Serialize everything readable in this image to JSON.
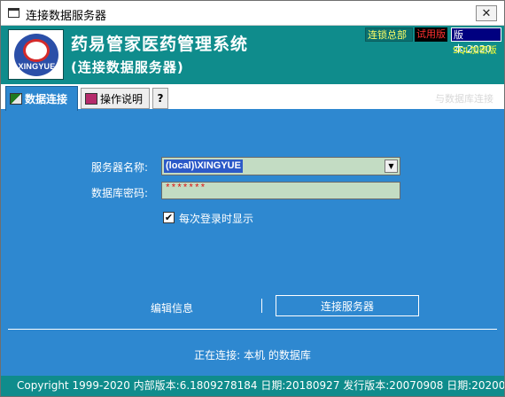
{
  "window": {
    "title": "连接数据服务器",
    "close_glyph": "✕"
  },
  "header": {
    "logo_text": "XINGYUE",
    "app_title": "药易管家医药管理系统",
    "subtitle": "(连接数据服务器)",
    "badges": {
      "chain": "连锁总部",
      "trial": "试用版",
      "version": "版本:2020"
    },
    "sql_label": "SQL加密版"
  },
  "tabs": {
    "connect": "数据连接",
    "help": "操作说明",
    "question": "?",
    "faint_right": "与数据库连接"
  },
  "form": {
    "server_label": "服务器名称:",
    "server_value": "(local)\\XINGYUE",
    "password_label": "数据库密码:",
    "password_value": "*******",
    "show_each_login_label": "每次登录时显示",
    "show_each_login_checked": true
  },
  "actions": {
    "edit_info": "编辑信息",
    "connect_button": "连接服务器"
  },
  "status": "正在连接: 本机 的数据库",
  "footer": "Copyright 1999-2020  内部版本:6.1809278184 日期:20180927  发行版本:20070908 日期:20200709",
  "colors": {
    "panel_blue": "#2e88d0",
    "header_teal": "#0f8c8c",
    "input_green": "#c3dcc3"
  }
}
